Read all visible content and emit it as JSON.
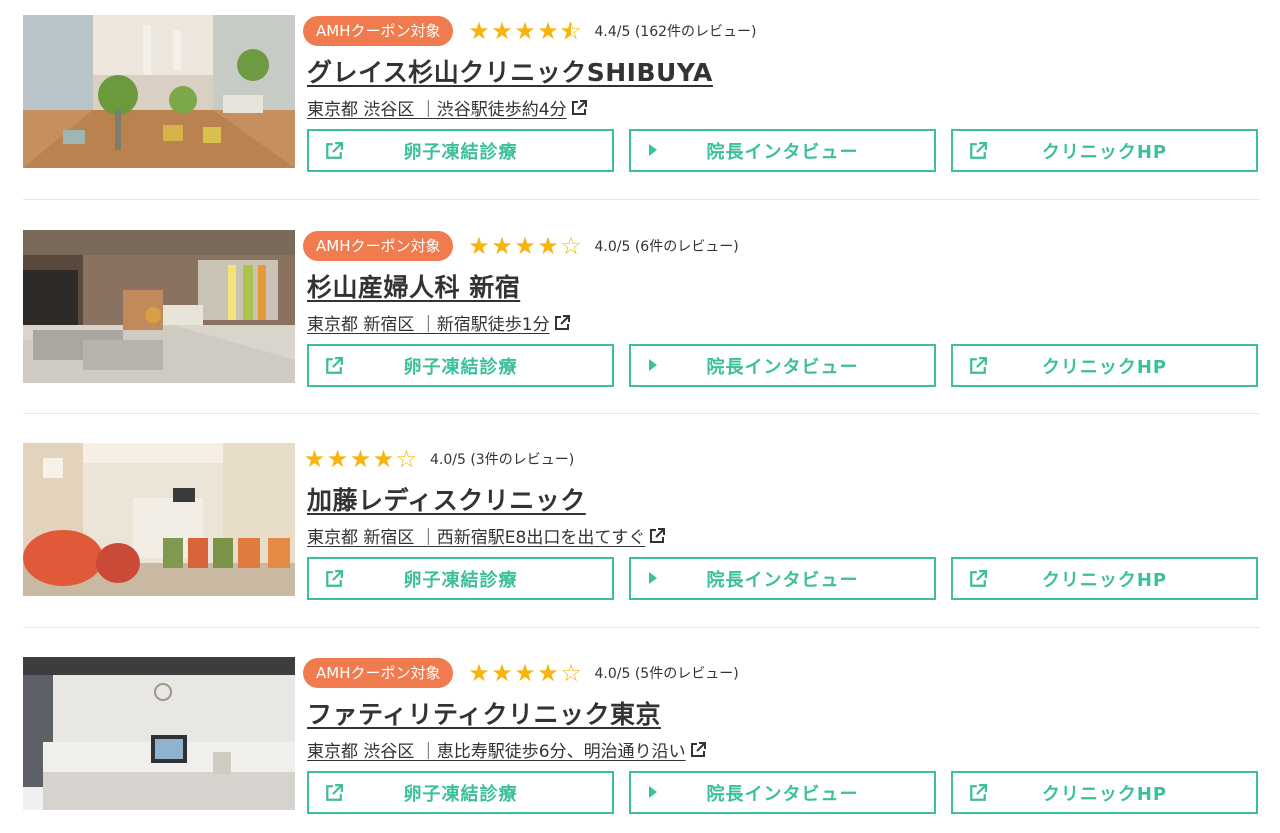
{
  "clinics": [
    {
      "badge": "AMHクーポン対象",
      "rating_text": "4.4/5 (162件のレビュー)",
      "rating_value": 4.4,
      "name": "グレイス杉山クリニックSHIBUYA",
      "address": "東京都 渋谷区 ｜渋谷駅徒歩約4分",
      "btn_egg": "卵子凍結診療",
      "btn_interview": "院長インタビュー",
      "btn_hp": "クリニックHP"
    },
    {
      "badge": "AMHクーポン対象",
      "rating_text": "4.0/5 (6件のレビュー)",
      "rating_value": 4.0,
      "name": "杉山産婦人科 新宿",
      "address": "東京都 新宿区 ｜新宿駅徒歩1分",
      "btn_egg": "卵子凍結診療",
      "btn_interview": "院長インタビュー",
      "btn_hp": "クリニックHP"
    },
    {
      "badge": "",
      "rating_text": "4.0/5 (3件のレビュー)",
      "rating_value": 4.0,
      "name": "加藤レディスクリニック",
      "address": "東京都 新宿区 ｜西新宿駅E8出口を出てすぐ",
      "btn_egg": "卵子凍結診療",
      "btn_interview": "院長インタビュー",
      "btn_hp": "クリニックHP"
    },
    {
      "badge": "AMHクーポン対象",
      "rating_text": "4.0/5 (5件のレビュー)",
      "rating_value": 4.0,
      "name": "ファティリティクリニック東京",
      "address": "東京都 渋谷区 ｜恵比寿駅徒歩6分、明治通り沿い",
      "btn_egg": "卵子凍結診療",
      "btn_interview": "院長インタビュー",
      "btn_hp": "クリニックHP"
    }
  ],
  "colors": {
    "accent_green": "#3cbf9b",
    "badge_orange": "#f07b4e",
    "star_gold": "#f6b40c",
    "text_dark": "#333333"
  },
  "icons": {
    "external_link": "external-link-icon",
    "play": "play-icon",
    "star": "star-icon"
  }
}
